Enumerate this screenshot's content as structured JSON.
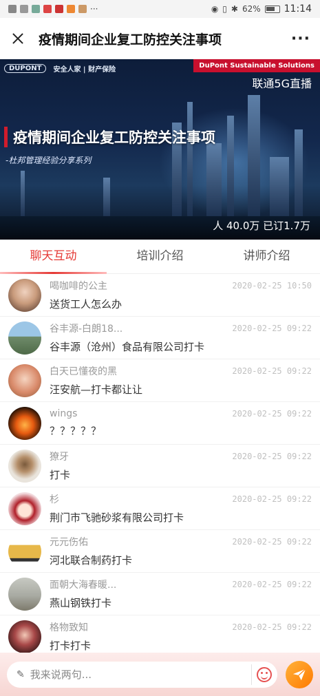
{
  "status_bar": {
    "battery": "62%",
    "time": "11:14",
    "extra": "···"
  },
  "header": {
    "title": "疫情期间企业复工防控关注事项",
    "more": "···"
  },
  "banner": {
    "logo_left": "DUPONT",
    "logo_right": "安全人家 | 财产保险",
    "tag": "DuPont Sustainable Solutions",
    "live_label": "联通5G直播",
    "title": "疫情期间企业复工防控关注事项",
    "subtitle": "-杜邦管理经验分享系列",
    "stats": "人 40.0万 已订1.7万"
  },
  "tabs": [
    {
      "label": "聊天互动",
      "active": true
    },
    {
      "label": "培训介绍",
      "active": false
    },
    {
      "label": "讲师介绍",
      "active": false
    }
  ],
  "messages": [
    {
      "name": "喝咖啡的公主",
      "time": "2020-02-25 10:50",
      "text": "送货工人怎么办",
      "avatar_icon": "portrait-avatar-icon",
      "avatar_color": "#c99b7c"
    },
    {
      "name": "谷丰源-白朗18...",
      "time": "2020-02-25 09:22",
      "text": "谷丰源（沧州）食品有限公司打卡",
      "avatar_icon": "factory-avatar-icon",
      "avatar_color": "#6fa3c9"
    },
    {
      "name": "白天已懂夜的黑",
      "time": "2020-02-25 09:22",
      "text": "汪安航—打卡都让让",
      "avatar_icon": "child-avatar-icon",
      "avatar_color": "#d98a6a"
    },
    {
      "name": "wings",
      "time": "2020-02-25 09:22",
      "text": "？？？？？",
      "avatar_icon": "fire-avatar-icon",
      "avatar_color": "#1a0d05"
    },
    {
      "name": "獠牙",
      "time": "2020-02-25 09:22",
      "text": "打卡",
      "avatar_icon": "cartoon-avatar-icon",
      "avatar_color": "#e9e4dc"
    },
    {
      "name": "杉",
      "time": "2020-02-25 09:22",
      "text": "荆门市飞驰砂浆有限公司打卡",
      "avatar_icon": "doll-avatar-icon",
      "avatar_color": "#f3dde0"
    },
    {
      "name": "元元伤佑",
      "time": "2020-02-25 09:22",
      "text": "河北联合制药打卡",
      "avatar_icon": "car-avatar-icon",
      "avatar_color": "#e7b84a"
    },
    {
      "name": "面朝大海春暖...",
      "time": "2020-02-25 09:22",
      "text": "燕山钢铁打卡",
      "avatar_icon": "beach-avatar-icon",
      "avatar_color": "#a8aaa2"
    },
    {
      "name": "格物致知",
      "time": "2020-02-25 09:22",
      "text": "打卡打卡",
      "avatar_icon": "photo-avatar-icon",
      "avatar_color": "#3a1a1a"
    }
  ],
  "input": {
    "placeholder": "我来说两句..."
  },
  "colors": {
    "accent": "#e53935",
    "send": "#ff8c1a"
  }
}
